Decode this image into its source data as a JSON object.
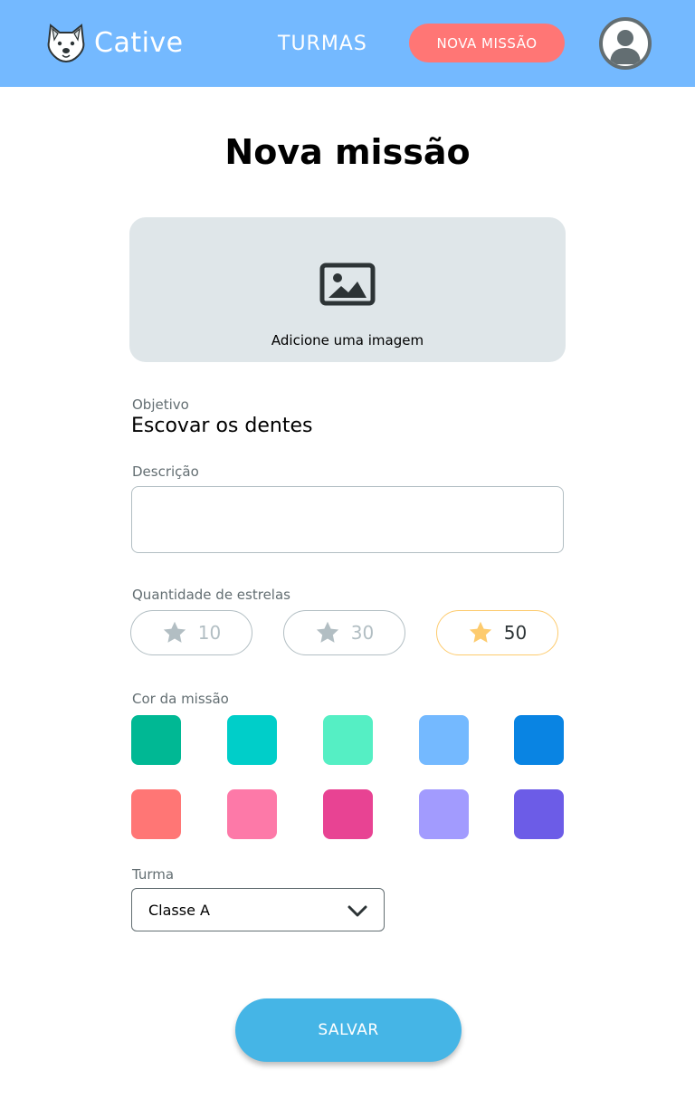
{
  "header": {
    "logo_icon": "dog-face-icon",
    "brand": "Cative",
    "nav_turmas": "TURMAS",
    "nav_nova_missao": "NOVA MISSÃO",
    "avatar_icon": "user-icon"
  },
  "page": {
    "title": "Nova missão"
  },
  "image_upload": {
    "icon": "image-icon",
    "label": "Adicione uma imagem"
  },
  "form": {
    "objetivo_label": "Objetivo",
    "objetivo_value": "Escovar os dentes",
    "descricao_label": "Descrição",
    "descricao_value": "",
    "estrelas_label": "Quantidade de estrelas",
    "star_options": [
      {
        "value": "10",
        "selected": false
      },
      {
        "value": "30",
        "selected": false
      },
      {
        "value": "50",
        "selected": true
      }
    ],
    "cor_label": "Cor da missão",
    "colors": [
      "#00b894",
      "#00cec9",
      "#55efc4",
      "#74b9ff",
      "#0984e3",
      "#ff7675",
      "#fd79a8",
      "#e84393",
      "#a29bfe",
      "#6c5ce7"
    ],
    "turma_label": "Turma",
    "turma_value": "Classe A"
  },
  "actions": {
    "save_label": "SALVAR"
  },
  "theme": {
    "header_bg": "#74b9ff",
    "accent_red": "#ff7675",
    "save_bg": "#45b5e6",
    "star_selected": "#fdcb6e",
    "star_unselected": "#b2bec3"
  }
}
